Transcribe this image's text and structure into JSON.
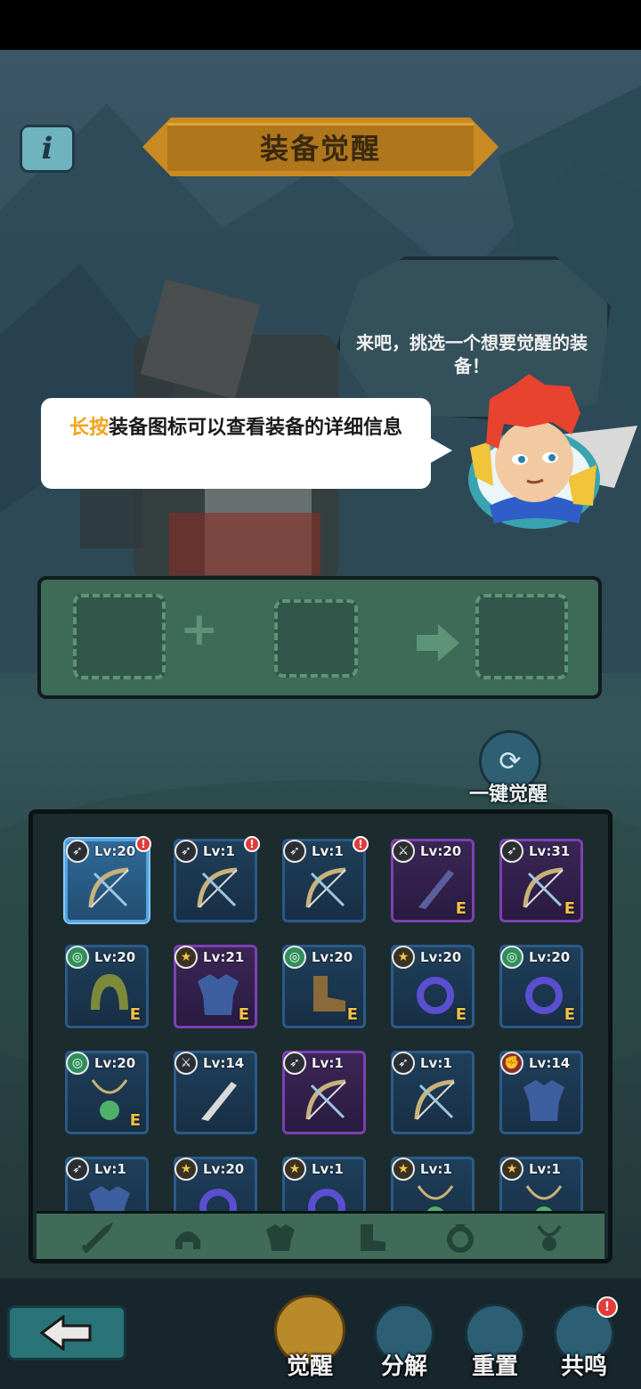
{
  "header": {
    "title": "装备觉醒",
    "info_icon": "info-icon"
  },
  "guide": {
    "hero_line": "来吧，挑选一个想要觉醒的装备！",
    "hint_highlight": "长按",
    "hint_rest": "装备图标可以查看装备的详细信息"
  },
  "merge": {
    "plus_symbol": "+",
    "arrow_icon": "arrow-right-icon"
  },
  "auto_awaken": {
    "label": "一键觉醒",
    "icon": "refresh-cycle-icon"
  },
  "items": [
    {
      "level": "Lv:20",
      "type": "bow",
      "type_icon": "bow-icon",
      "alert": "!",
      "badge": "",
      "rarity": "rare",
      "selected": true
    },
    {
      "level": "Lv:1",
      "type": "bow",
      "type_icon": "bow-icon",
      "alert": "!",
      "badge": "",
      "rarity": "rare"
    },
    {
      "level": "Lv:1",
      "type": "bow",
      "type_icon": "bow-icon",
      "alert": "!",
      "badge": "",
      "rarity": "rare"
    },
    {
      "level": "Lv:20",
      "type": "blade",
      "type_icon": "sword-icon",
      "alert": "",
      "badge": "E",
      "rarity": "epic"
    },
    {
      "level": "Lv:31",
      "type": "bow",
      "type_icon": "bow-icon",
      "alert": "",
      "badge": "E",
      "rarity": "epic"
    },
    {
      "level": "Lv:20",
      "type": "hood",
      "type_icon": "target-icon",
      "alert": "",
      "badge": "E",
      "rarity": "rare"
    },
    {
      "level": "Lv:21",
      "type": "armor",
      "type_icon": "star-icon",
      "alert": "",
      "badge": "E",
      "rarity": "epic"
    },
    {
      "level": "Lv:20",
      "type": "boots",
      "type_icon": "target-icon",
      "alert": "",
      "badge": "E",
      "rarity": "rare"
    },
    {
      "level": "Lv:20",
      "type": "ring",
      "type_icon": "star-icon",
      "alert": "",
      "badge": "E",
      "rarity": "rare"
    },
    {
      "level": "Lv:20",
      "type": "ring",
      "type_icon": "target-icon",
      "alert": "",
      "badge": "E",
      "rarity": "rare"
    },
    {
      "level": "Lv:20",
      "type": "amulet",
      "type_icon": "target-icon",
      "alert": "",
      "badge": "E",
      "rarity": "rare"
    },
    {
      "level": "Lv:14",
      "type": "dagger",
      "type_icon": "sword-icon",
      "alert": "",
      "badge": "",
      "rarity": "rare"
    },
    {
      "level": "Lv:1",
      "type": "bow",
      "type_icon": "bow-icon",
      "alert": "",
      "badge": "",
      "rarity": "epic"
    },
    {
      "level": "Lv:1",
      "type": "bow",
      "type_icon": "bow-icon",
      "alert": "",
      "badge": "",
      "rarity": "rare"
    },
    {
      "level": "Lv:14",
      "type": "armor",
      "type_icon": "fist-icon",
      "alert": "",
      "badge": "",
      "rarity": "rare"
    },
    {
      "level": "Lv:1",
      "type": "armor",
      "type_icon": "bow-icon",
      "alert": "",
      "badge": "",
      "rarity": "rare"
    },
    {
      "level": "Lv:20",
      "type": "ring",
      "type_icon": "star-icon",
      "alert": "",
      "badge": "",
      "rarity": "rare"
    },
    {
      "level": "Lv:1",
      "type": "ring",
      "type_icon": "star-icon",
      "alert": "",
      "badge": "",
      "rarity": "rare"
    },
    {
      "level": "Lv:1",
      "type": "amulet",
      "type_icon": "star-icon",
      "alert": "",
      "badge": "",
      "rarity": "rare"
    },
    {
      "level": "Lv:1",
      "type": "amulet",
      "type_icon": "star-icon",
      "alert": "",
      "badge": "",
      "rarity": "rare"
    }
  ],
  "filters": [
    "sword-filter-icon",
    "helmet-filter-icon",
    "armor-filter-icon",
    "boots-filter-icon",
    "ring-filter-icon",
    "amulet-filter-icon"
  ],
  "bottom_nav": {
    "back_icon": "arrow-left-icon",
    "awaken": "觉醒",
    "decompose": "分解",
    "reset": "重置",
    "resonance": "共鸣",
    "resonance_alert": "!"
  },
  "colors": {
    "title_banner": "#c98a21",
    "hint_highlight": "#f4a21c",
    "epic_border": "#7e3fb4",
    "rare_border": "#2a5a8a",
    "alert": "#e13b3b"
  }
}
